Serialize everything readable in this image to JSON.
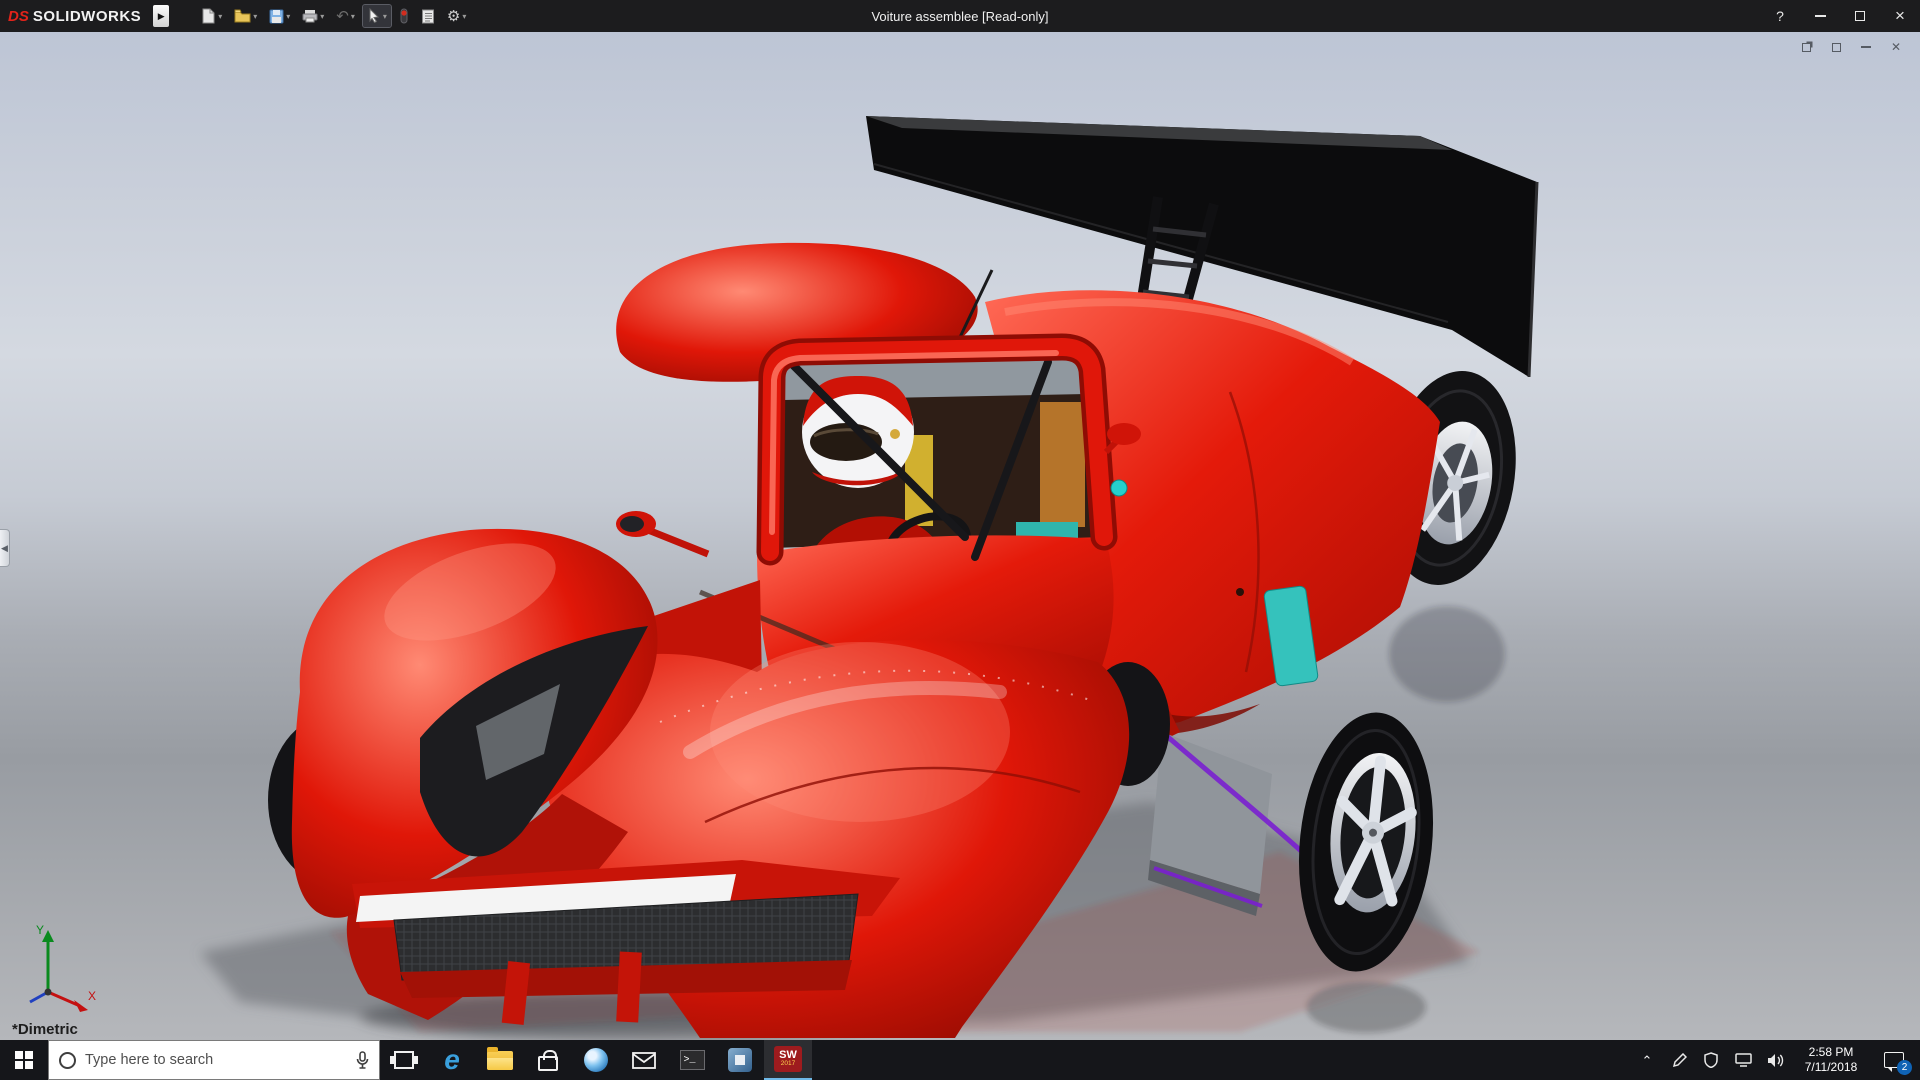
{
  "window": {
    "title": "Voiture assemblee [Read-only]",
    "brand": {
      "ds": "DS",
      "name": "SOLIDWORKS"
    },
    "controls": {
      "help": "?",
      "close": "×"
    },
    "toolbar_icons": [
      "new-document",
      "open",
      "save",
      "print",
      "undo",
      "select",
      "rebuild",
      "file-properties",
      "options"
    ]
  },
  "viewport": {
    "view_label": "*Dimetric",
    "triad": {
      "x": "X",
      "y": "Y"
    },
    "doc_controls": [
      "doc-restore",
      "doc-pin",
      "doc-minimize",
      "doc-close"
    ]
  },
  "model": {
    "description": "red Le Mans prototype race car assembly with driver, black rear wing, silver wheels"
  },
  "taskbar": {
    "search": {
      "placeholder": "Type here to search"
    },
    "apps": [
      "start",
      "search",
      "task-view",
      "edge",
      "file-explorer",
      "store",
      "browser",
      "mail",
      "command-prompt",
      "app",
      "solidworks-2017"
    ],
    "edge_glyph": "e",
    "cmd_glyph": ">_",
    "solidworks": {
      "line1": "SW",
      "line2": "2017"
    },
    "tray": {
      "time": "2:58 PM",
      "date": "7/11/2018",
      "badge": "2"
    }
  },
  "colors": {
    "titlebar-bg": "#1c1c1e",
    "taskbar-bg": "#15161a",
    "car-red": "#dd1505",
    "car-red-dark": "#9a0b02",
    "wing-black": "#0d0d0e",
    "cyan-accent": "#2fb5ad",
    "purple-accent": "#7a1fd0",
    "silver": "#d9dde3",
    "bg-top": "#c3cbd9",
    "bg-floor": "#9b9fa6"
  }
}
